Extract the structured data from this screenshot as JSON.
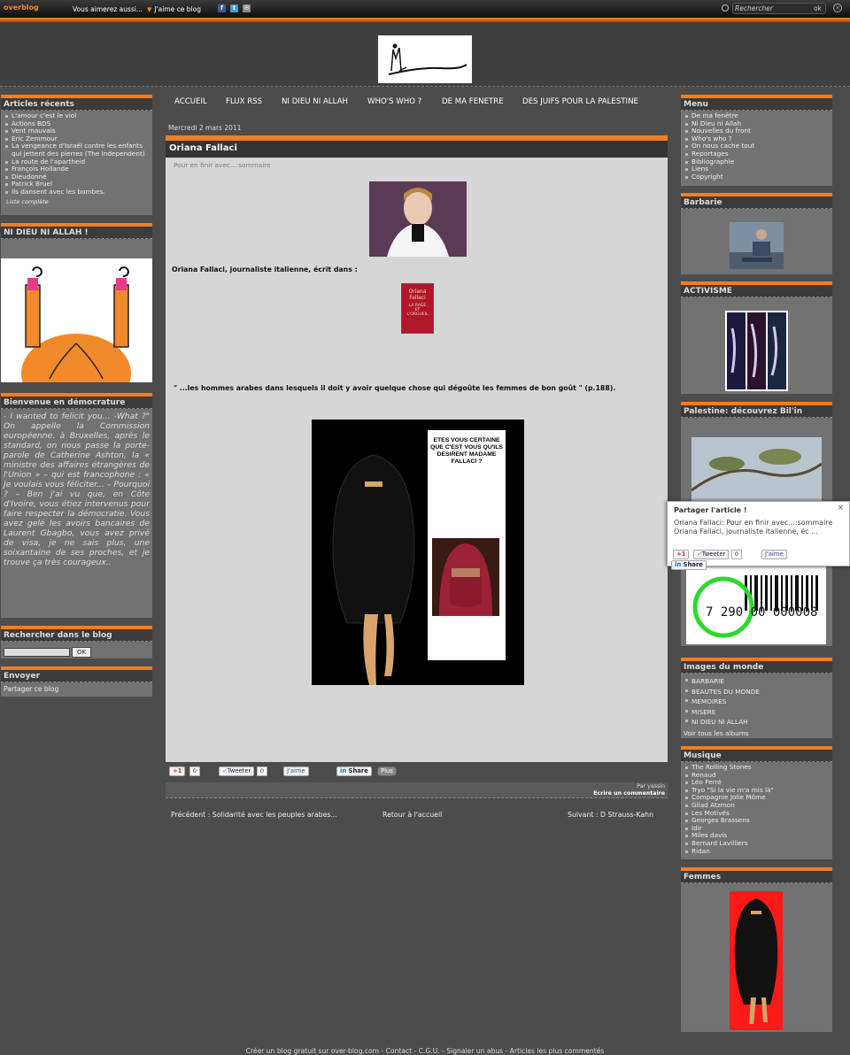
{
  "topbar": {
    "logo": "overblog",
    "aimerez": "Vous aimerez aussi...",
    "jaime": "J'aime ce blog",
    "search_placeholder": "Rechercher",
    "ok": "ok"
  },
  "left": {
    "recent": {
      "title": "Articles récents",
      "items": [
        "L'amour c'est le viol",
        "Actions BDS",
        "Vent mauvais",
        "Eric Zemmour",
        "La vengeance d'Israël contre les enfants qui jettent des pierres (The Independent)",
        "La route de l'apartheid",
        "François Hollande",
        "Dieudonné",
        "Patrick Bruel",
        "Ils dansent avec les bombes."
      ],
      "more": "Liste complète"
    },
    "ndna": {
      "title": "NI DIEU NI ALLAH !"
    },
    "demo": {
      "title": "Bienvenue en démocrature",
      "text": "- I wanted to felicit you... -What ?\" On appelle la Commission européenne. à Bruxelles, après le standard, on nous passe la porte-parole de Catherine Ashton, la « ministre des affaires étrangères de l'Union » – qui est francophone : « Je voulais vous féliciter... – Pourquoi ? – Ben j'ai vu que, en Côte d'Ivoire, vous étiez intervenus pour faire respecter la démocratie. Vous avez gelé les avoirs bancaires de Laurent Gbagbo, vous avez privé de visa, je ne sais plus, une soixantaine de ses proches, et je trouve ça très courageux.."
    },
    "search": {
      "title": "Rechercher dans le blog",
      "ok": "OK"
    },
    "send": {
      "title": "Envoyer",
      "share": "Partager ce blog"
    }
  },
  "nav": [
    "ACCUEIL",
    "FLUX RSS",
    "NI DIEU NI ALLAH",
    "WHO'S WHO ?",
    "DE MA FENETRE",
    "DES JUIFS POUR LA PALESTINE"
  ],
  "article": {
    "date": "Mercredi 2 mars 2011",
    "title": "Oriana Fallaci",
    "subtitle": "Pour en finir avec...:sommaire",
    "line1": "Oriana Fallaci,  journaliste italienne,  écrit dans :",
    "book": {
      "t1": "Oriana",
      "t2": "Fallaci",
      "t3": "LA RAGE",
      "t4": "ET",
      "t5": "L'ORGUEIL"
    },
    "quote": "\" ...les hommes arabes dans lesquels il doit y avoir quelque chose qui dégoûte les femmes de bon goût \" (p.188).",
    "poster_text": "ETES VOUS CERTAINE QUE C'EST VOUS QU'ILS DESIRENT MADAME FALLACI ?",
    "share": {
      "gplus": "+1",
      "gcount": "0",
      "tweet": "Tweeter",
      "tcount": "0",
      "fb": "J'aime",
      "li": "Share",
      "plus": "Plus"
    },
    "by": "Par yassin",
    "comment": "Ecrire un commentaire"
  },
  "prevnext": {
    "prev": "Précédent : Solidarité avec les peuples arabes...",
    "home": "Retour à l'accueil",
    "next": "Suivant : D Strauss-Kahn"
  },
  "right": {
    "menu": {
      "title": "Menu",
      "items": [
        "De ma fenêtre",
        "Ni Dieu ni Allah",
        "Nouvelles du front",
        "Who's who ?",
        "On nous cache tout",
        "Reportages",
        "Bibliographie",
        "Liens",
        "Copyright"
      ]
    },
    "barbarie": {
      "title": "Barbarie"
    },
    "activisme": {
      "title": "ACTIVISME"
    },
    "palestine": {
      "title": "Palestine: découvrez Bil'in"
    },
    "barcode": {
      "digits": "7  290  00  000008"
    },
    "images": {
      "title": "Images du monde",
      "items": [
        "BARBARIE",
        "BEAUTES DU MONDE",
        "MEMOIRES",
        "MISERE",
        "NI DIEU NI ALLAH"
      ],
      "more": "Voir tous les albums"
    },
    "musique": {
      "title": "Musique",
      "items": [
        "The Rolling Stones",
        "Renaud",
        "Léo Ferré",
        "Tryo \"Si la vie m'a mis là\"",
        "Compagnie Jolie Môme",
        "Gilad Atzmon",
        "Les Motivés",
        "Georges Brassens",
        "Idir",
        "Miles davis",
        "Bernard Lavilliers",
        "Ridan"
      ]
    },
    "femmes": {
      "title": "Femmes"
    }
  },
  "popup": {
    "title": "Partager l'article !",
    "line1": "Oriana Fallaci:  Pour en finir avec...:sommaire",
    "line2": "Oriana Fallaci,  journaliste italienne,  éc ...",
    "gplus": "+1",
    "tweet": "Tweeter",
    "tcount": "0",
    "fb": "J'aime",
    "li": "Share"
  },
  "footer": "Créer un blog gratuit sur over-blog.com - Contact - C.G.U. - Signaler un abus - Articles les plus commentés"
}
